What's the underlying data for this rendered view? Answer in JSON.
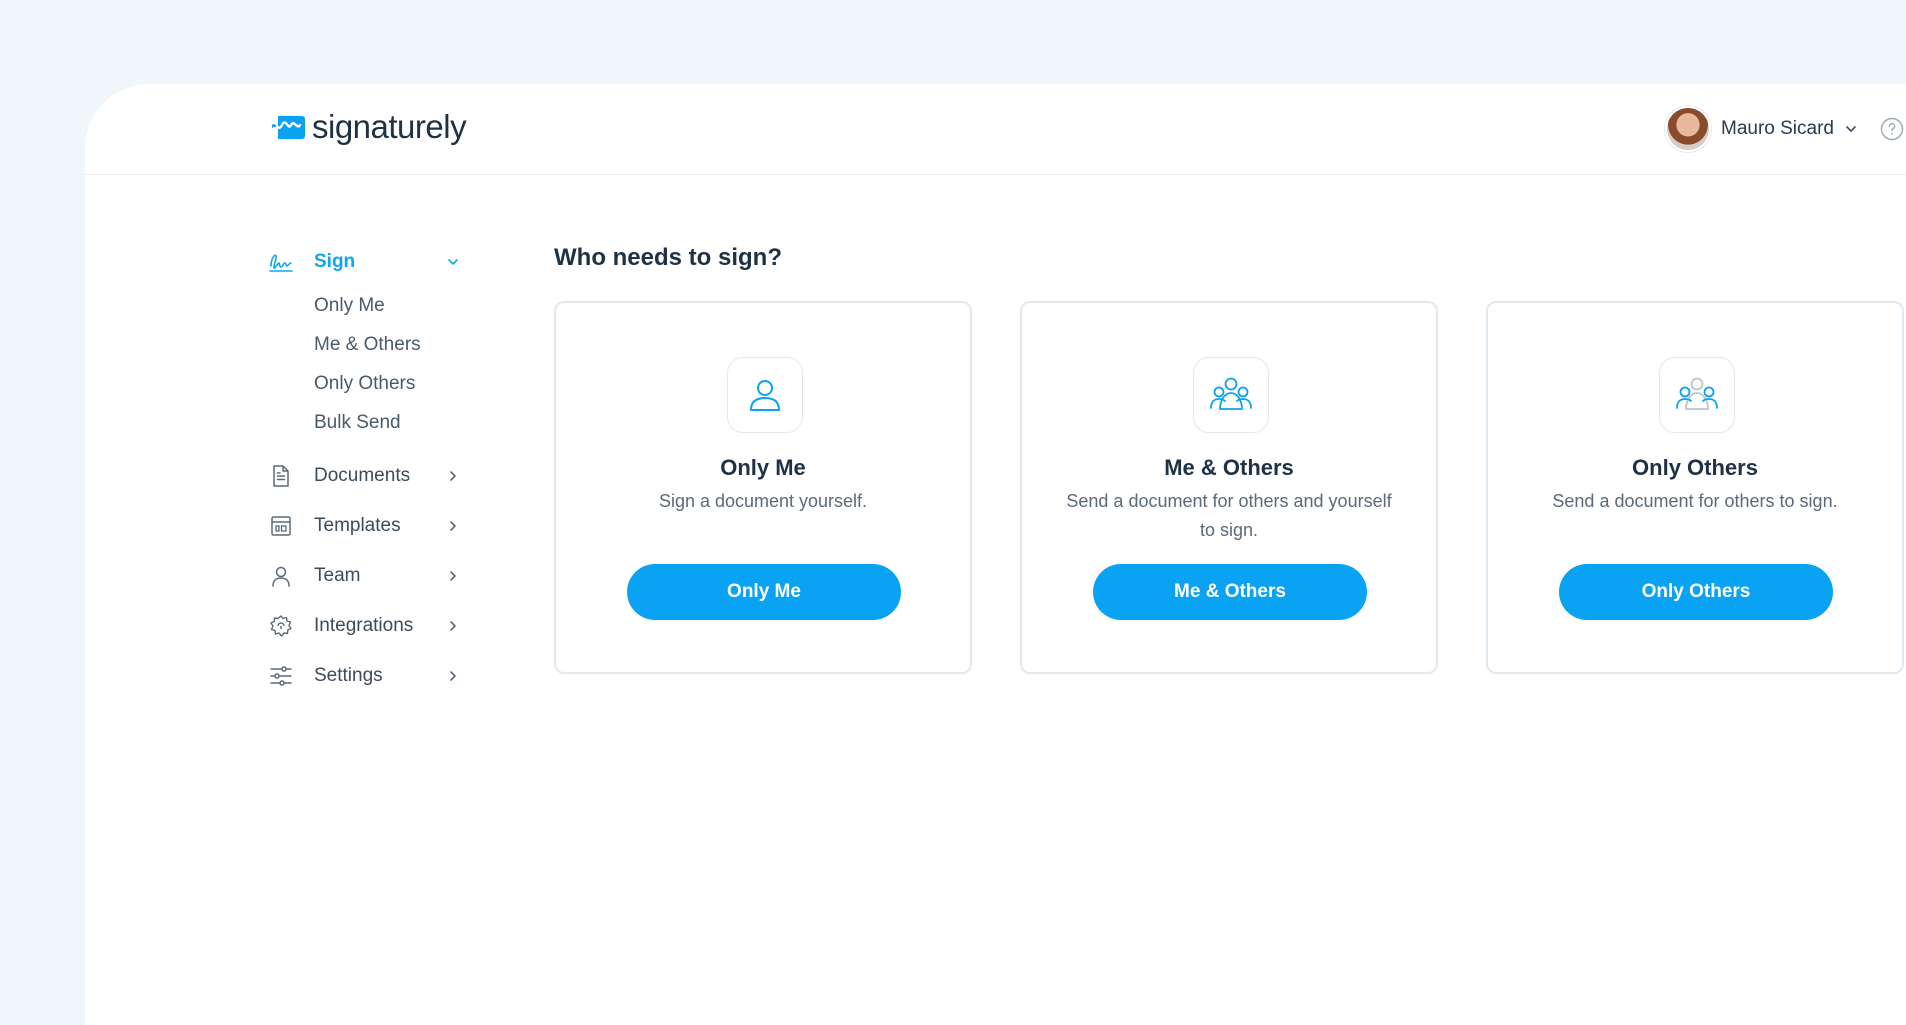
{
  "app": {
    "brand": "signaturely",
    "accent_color": "#0aa3f3"
  },
  "header": {
    "user_name": "Mauro Sicard"
  },
  "sidebar": {
    "sign": {
      "label": "Sign",
      "items": [
        "Only Me",
        "Me & Others",
        "Only Others",
        "Bulk Send"
      ]
    },
    "items": [
      {
        "label": "Documents",
        "icon": "document-icon"
      },
      {
        "label": "Templates",
        "icon": "template-icon"
      },
      {
        "label": "Team",
        "icon": "user-icon"
      },
      {
        "label": "Integrations",
        "icon": "gear-puzzle-icon"
      },
      {
        "label": "Settings",
        "icon": "sliders-icon"
      }
    ]
  },
  "main": {
    "title": "Who needs to sign?",
    "cards": [
      {
        "title": "Only Me",
        "desc": "Sign a document yourself.",
        "button": "Only Me",
        "icon": "single-user-icon"
      },
      {
        "title": "Me & Others",
        "desc": "Send a document for others and yourself to sign.",
        "button": "Me & Others",
        "icon": "group-icon"
      },
      {
        "title": "Only Others",
        "desc": "Send a document for others to sign.",
        "button": "Only Others",
        "icon": "others-group-icon"
      }
    ]
  }
}
